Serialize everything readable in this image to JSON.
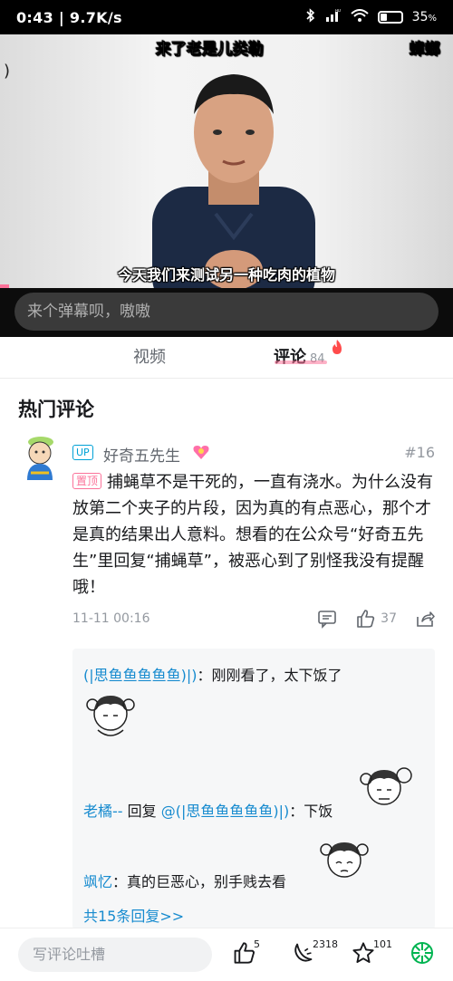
{
  "status_bar": {
    "time_speed": "0:43 | 9.7K/s",
    "battery": "35",
    "battery_level": 0.35
  },
  "video": {
    "danmaku": [
      "来了老是儿类勒",
      "蟑螂"
    ],
    "subtitle": "今天我们来测试另一种吃肉的植物",
    "danmaku_input_placeholder": "来个弹幕呗，嗷嗷",
    "progress": 0.02
  },
  "tabs": [
    {
      "label": "视频",
      "active": false
    },
    {
      "label": "评论",
      "active": true,
      "count": "84"
    }
  ],
  "comments": {
    "section_title": "热门评论",
    "top_comment": {
      "up_badge": "UP",
      "username": "好奇五先生",
      "floor": "#16",
      "pin_label": "置顶",
      "text": "捕蝇草不是干死的，一直有浇水。为什么没有放第二个夹子的片段，因为真的有点恶心，那个才是真的结果出人意料。想看的在公众号“好奇五先生”里回复“捕蝇草”，被恶心到了别怪我没有提醒哦！",
      "time": "11-11 00:16",
      "likes": "37"
    },
    "replies": [
      {
        "name": "(|思鱼鱼鱼鱼鱼)|)",
        "separator": "：",
        "text": "刚刚看了，太下饭了"
      },
      {
        "name": "老橘--",
        "reply_word": " 回复 ",
        "mention": "@(|思鱼鱼鱼鱼鱼)|)",
        "separator": "：",
        "text": "下饭"
      },
      {
        "name": "飒忆",
        "separator": "：",
        "text": "真的巨恶心，别手贱去看"
      }
    ],
    "more_replies": "共15条回复>>"
  },
  "bottom_bar": {
    "write_placeholder": "写评论吐槽",
    "like_count": "5",
    "coin_count": "2318",
    "favorite_count": "101"
  },
  "colors": {
    "accent_pink": "#fb7299",
    "link_blue": "#178bcf",
    "share_green": "#00b451"
  }
}
